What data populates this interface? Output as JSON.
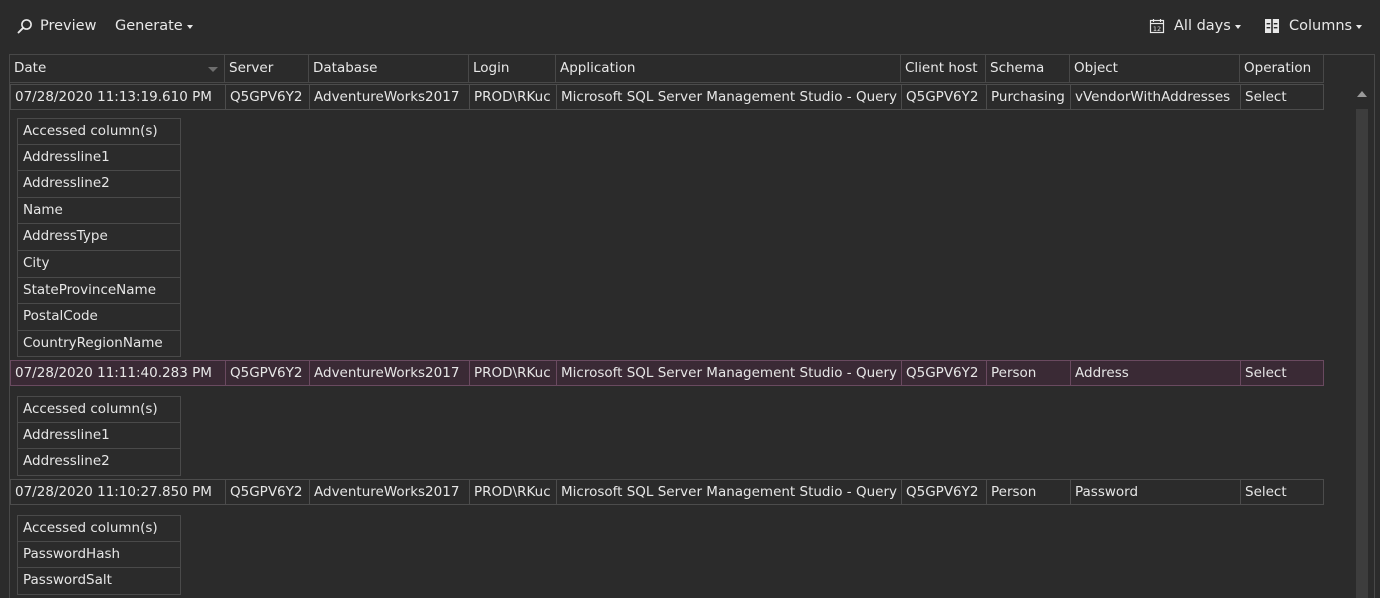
{
  "toolbar": {
    "preview_label": "Preview",
    "generate_label": "Generate",
    "days_label": "All days",
    "columns_label": "Columns"
  },
  "grid": {
    "columns": [
      "Date",
      "Server",
      "Database",
      "Login",
      "Application",
      "Client host",
      "Schema",
      "Object",
      "Operation"
    ],
    "subgrid_header": "Accessed column(s)",
    "rows": [
      {
        "date": "07/28/2020 11:13:19.610 PM",
        "server": "Q5GPV6Y2",
        "database": "AdventureWorks2017",
        "login": "PROD\\RKuc",
        "application": "Microsoft SQL Server Management Studio - Query",
        "client_host": "Q5GPV6Y2",
        "schema": "Purchasing",
        "object": "vVendorWithAddresses",
        "operation": "Select",
        "accessed_columns": [
          "Addressline1",
          "Addressline2",
          "Name",
          "AddressType",
          "City",
          "StateProvinceName",
          "PostalCode",
          "CountryRegionName"
        ]
      },
      {
        "date": "07/28/2020 11:11:40.283 PM",
        "server": "Q5GPV6Y2",
        "database": "AdventureWorks2017",
        "login": "PROD\\RKuc",
        "application": "Microsoft SQL Server Management Studio - Query",
        "client_host": "Q5GPV6Y2",
        "schema": "Person",
        "object": "Address",
        "operation": "Select",
        "accessed_columns": [
          "Addressline1",
          "Addressline2"
        ]
      },
      {
        "date": "07/28/2020 11:10:27.850 PM",
        "server": "Q5GPV6Y2",
        "database": "AdventureWorks2017",
        "login": "PROD\\RKuc",
        "application": "Microsoft SQL Server Management Studio - Query",
        "client_host": "Q5GPV6Y2",
        "schema": "Person",
        "object": "Password",
        "operation": "Select",
        "accessed_columns": [
          "PasswordHash",
          "PasswordSalt"
        ]
      }
    ]
  },
  "colors": {
    "background": "#2b2b2b",
    "selected_row": "#3a2a35",
    "grid_line": "#4c4c4c",
    "text": "#e6e6e6"
  }
}
